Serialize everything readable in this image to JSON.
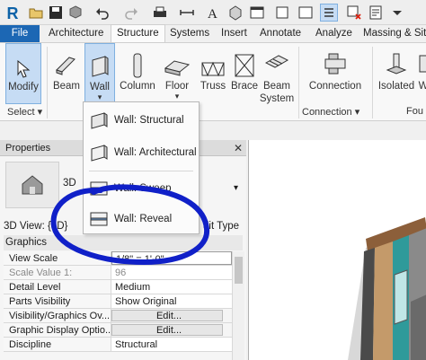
{
  "quick_access": {
    "logo": "R",
    "icons": [
      "open-icon",
      "save-icon",
      "sync-icon",
      "undo-icon",
      "redo-icon",
      "print-icon",
      "measure-icon",
      "text-icon",
      "3d-view-icon",
      "switch-windows-icon",
      "close-hidden-icon",
      "sheet-icon"
    ]
  },
  "tabs": [
    "File",
    "Architecture",
    "Structure",
    "Systems",
    "Insert",
    "Annotate",
    "Analyze",
    "Massing & Site"
  ],
  "active_tab": "Structure",
  "ribbon": {
    "tools": {
      "modify": "Modify",
      "beam": "Beam",
      "wall": "Wall",
      "column": "Column",
      "floor": "Floor",
      "truss": "Truss",
      "brace": "Brace",
      "beam_system_1": "Beam",
      "beam_system_2": "System",
      "connection": "Connection",
      "isolated": "Isolated",
      "wall_foundation": "W"
    },
    "panels": {
      "select": "Select ▾",
      "connection": "Connection ▾",
      "foundation": "Fou"
    }
  },
  "dropdown": {
    "items": [
      "Wall: Structural",
      "Wall: Architectural",
      "Wall: Sweep",
      "Wall: Reveal"
    ]
  },
  "properties": {
    "title": "Properties",
    "close": "✕",
    "type_partial": "3D",
    "view_label": "3D View: {3D}",
    "edit_type": "dit Type",
    "group": "Graphics",
    "rows": [
      {
        "key": "View Scale",
        "value": "1/8\" = 1'-0\""
      },
      {
        "key": "Scale Value    1:",
        "value": "96"
      },
      {
        "key": "Detail Level",
        "value": "Medium"
      },
      {
        "key": "Parts Visibility",
        "value": "Show Original"
      },
      {
        "key": "Visibility/Graphics Ov...",
        "value": "Edit..."
      },
      {
        "key": "Graphic Display Optio...",
        "value": "Edit..."
      },
      {
        "key": "Discipline",
        "value": "Structural"
      }
    ]
  },
  "colors": {
    "file_tab": "#1c67b4",
    "selected_tool": "#c6dcf4",
    "annotation_circle": "#1020c8"
  }
}
